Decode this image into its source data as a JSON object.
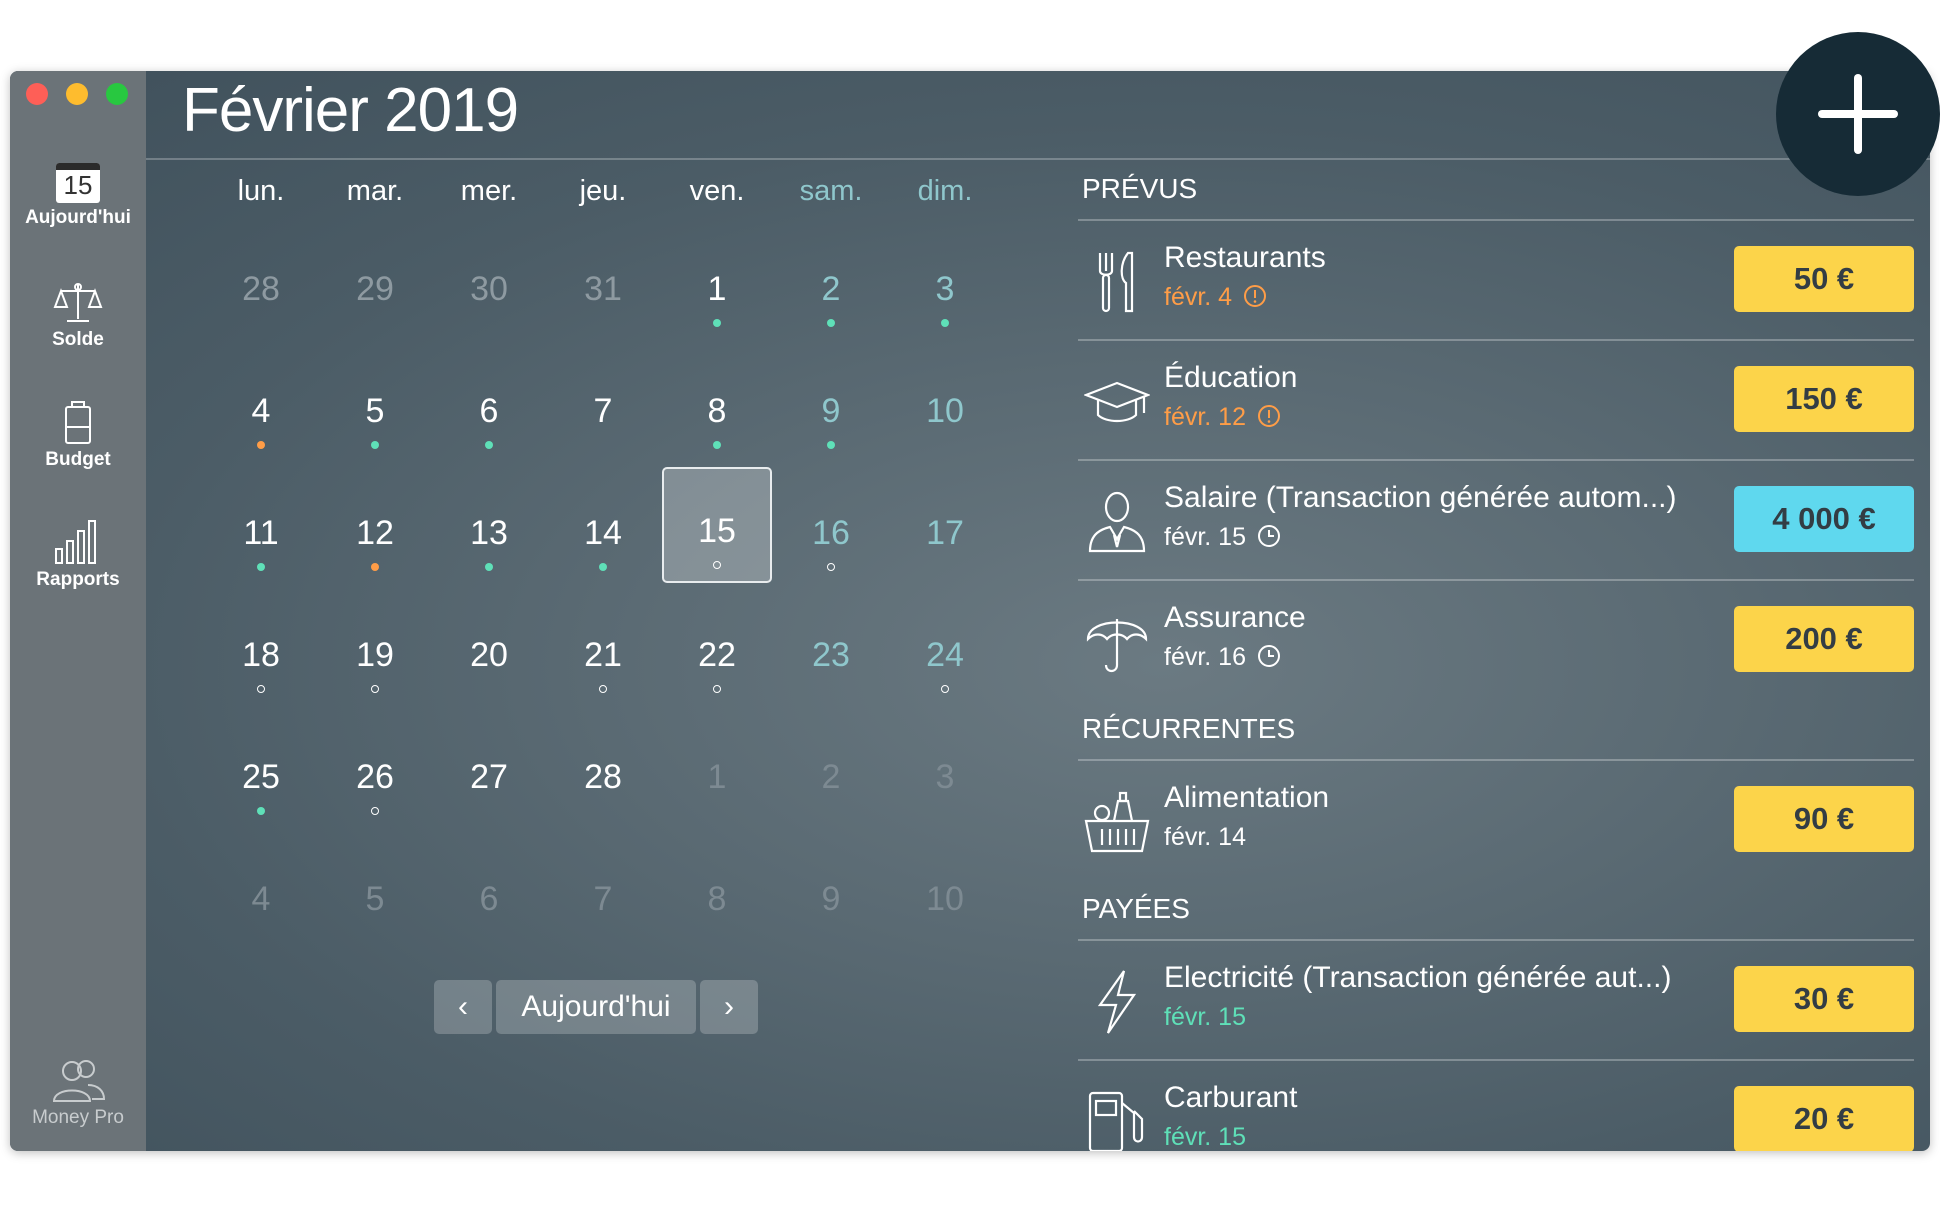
{
  "window": {
    "title": "Février 2019"
  },
  "sidebar": {
    "items": [
      {
        "label": "Aujourd'hui",
        "icon": "calendar-icon",
        "badge": "15"
      },
      {
        "label": "Solde",
        "icon": "balance-scale-icon"
      },
      {
        "label": "Budget",
        "icon": "battery-icon"
      },
      {
        "label": "Rapports",
        "icon": "bar-chart-icon"
      }
    ],
    "footer": {
      "label": "Money Pro",
      "icon": "users-icon"
    }
  },
  "calendar": {
    "weekdays": [
      "lun.",
      "mar.",
      "mer.",
      "jeu.",
      "ven.",
      "sam.",
      "dim."
    ],
    "weeks": [
      [
        "28",
        "29",
        "30",
        "31",
        "1",
        "2",
        "3"
      ],
      [
        "4",
        "5",
        "6",
        "7",
        "8",
        "9",
        "10"
      ],
      [
        "11",
        "12",
        "13",
        "14",
        "15",
        "16",
        "17"
      ],
      [
        "18",
        "19",
        "20",
        "21",
        "22",
        "23",
        "24"
      ],
      [
        "25",
        "26",
        "27",
        "28",
        "1",
        "2",
        "3"
      ],
      [
        "4",
        "5",
        "6",
        "7",
        "8",
        "9",
        "10"
      ]
    ],
    "selected_day": "15",
    "nav": {
      "prev": "‹",
      "today": "Aujourd'hui",
      "next": "›"
    }
  },
  "sections": [
    {
      "heading": "PRÉVUS",
      "items": [
        {
          "name": "Restaurants",
          "date": "févr. 4",
          "status_icon": "alert-circle-icon",
          "amount": "50 €",
          "icon": "fork-knife-icon"
        },
        {
          "name": "Éducation",
          "date": "févr. 12",
          "status_icon": "alert-circle-icon",
          "amount": "150 €",
          "icon": "graduation-cap-icon"
        },
        {
          "name": "Salaire (Transaction générée autom...)",
          "date": "févr. 15",
          "status_icon": "clock-icon",
          "amount": "4 000 €",
          "icon": "person-icon"
        },
        {
          "name": "Assurance",
          "date": "févr. 16",
          "status_icon": "clock-icon",
          "amount": "200 €",
          "icon": "umbrella-icon"
        }
      ]
    },
    {
      "heading": "RÉCURRENTES",
      "items": [
        {
          "name": "Alimentation",
          "date": "févr. 14",
          "amount": "90 €",
          "icon": "basket-icon"
        }
      ]
    },
    {
      "heading": "PAYÉES",
      "items": [
        {
          "name": "Electricité (Transaction générée aut...)",
          "date": "févr. 15",
          "amount": "30 €",
          "icon": "lightning-icon"
        },
        {
          "name": "Carburant",
          "date": "févr. 15",
          "amount": "20 €",
          "icon": "fuel-pump-icon"
        }
      ]
    }
  ],
  "fab": {
    "label": "+",
    "icon": "plus-icon"
  },
  "colors": {
    "accent_yellow": "#fcd44a",
    "accent_cyan": "#5fd8ee",
    "dot_green": "#5fe0b8",
    "dot_orange": "#ff9d47",
    "fab": "#162b36"
  }
}
